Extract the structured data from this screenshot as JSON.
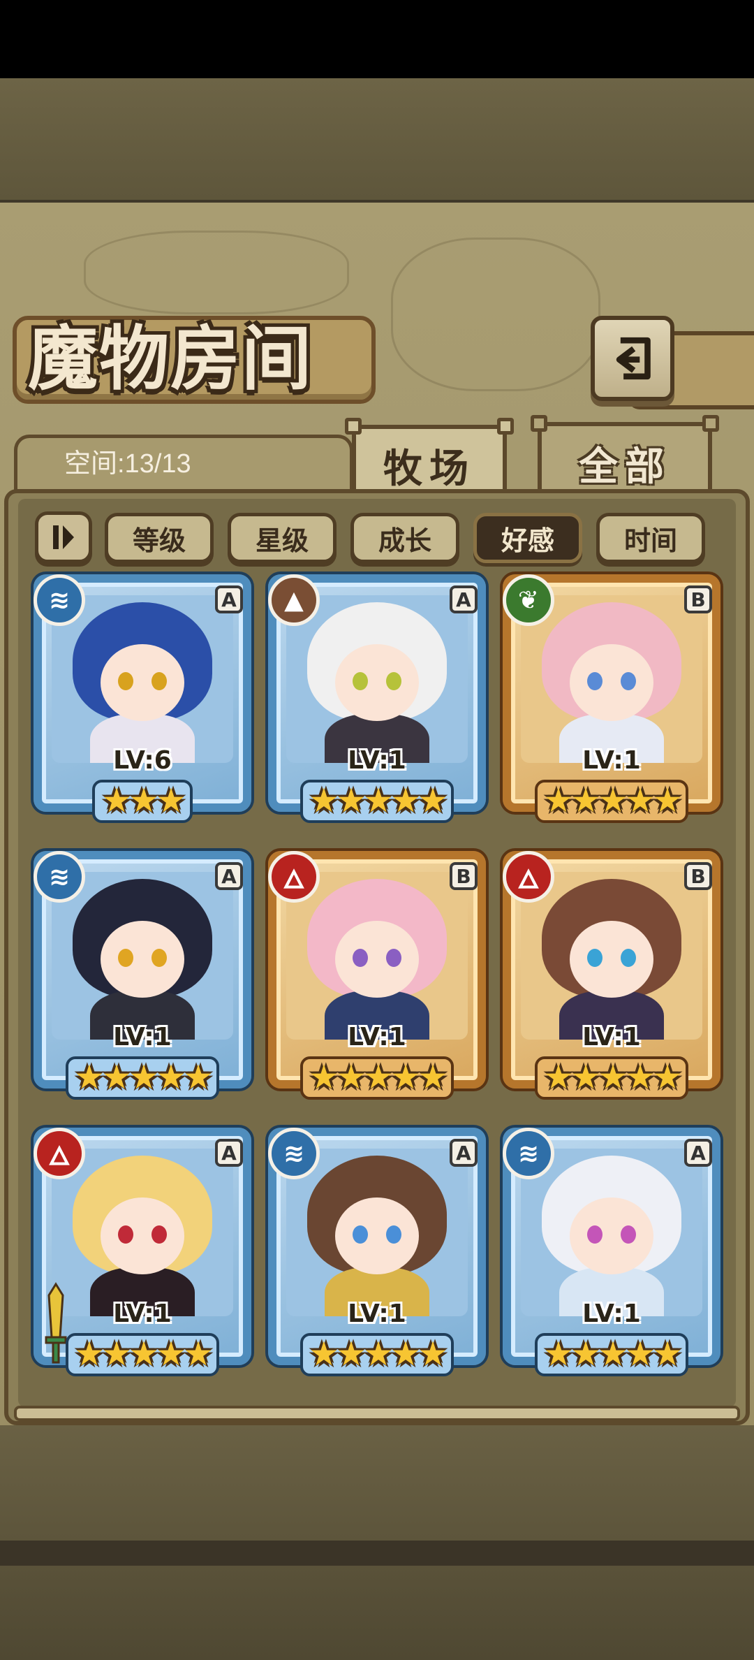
{
  "header": {
    "title": "魔物房间",
    "capacity_text": "空间:13/13"
  },
  "tabs": [
    {
      "label": "牧场",
      "active": true
    },
    {
      "label": "全部",
      "active": false
    }
  ],
  "sort_bar": {
    "buttons": [
      {
        "label": "等级",
        "active": false
      },
      {
        "label": "星级",
        "active": false
      },
      {
        "label": "成长",
        "active": false
      },
      {
        "label": "好感",
        "active": true
      },
      {
        "label": "时间",
        "active": false
      }
    ]
  },
  "monsters": [
    {
      "element": "water",
      "rank": "A",
      "level": "LV:6",
      "stars": 3,
      "frame": "blue",
      "hair": "#2b4fa8",
      "eyes": "#d8a21e",
      "outfit": "#e8e4ef"
    },
    {
      "element": "earth",
      "rank": "A",
      "level": "LV:1",
      "stars": 5,
      "frame": "blue",
      "hair": "#f0f0f0",
      "eyes": "#b6c23a",
      "outfit": "#3b3540"
    },
    {
      "element": "grass",
      "rank": "B",
      "level": "LV:1",
      "stars": 5,
      "frame": "gold",
      "hair": "#f1b9c4",
      "eyes": "#5a8bd6",
      "outfit": "#e6eaf4"
    },
    {
      "element": "water",
      "rank": "A",
      "level": "LV:1",
      "stars": 5,
      "frame": "blue",
      "hair": "#23263a",
      "eyes": "#e0a522",
      "outfit": "#2e2f3a"
    },
    {
      "element": "fire",
      "rank": "B",
      "level": "LV:1",
      "stars": 5,
      "frame": "gold",
      "hair": "#f3b8c8",
      "eyes": "#8a5fc2",
      "outfit": "#2f3f6e"
    },
    {
      "element": "fire",
      "rank": "B",
      "level": "LV:1",
      "stars": 5,
      "frame": "gold",
      "hair": "#7a4a36",
      "eyes": "#3aa3d6",
      "outfit": "#3a3150"
    },
    {
      "element": "fire",
      "rank": "A",
      "level": "LV:1",
      "stars": 5,
      "frame": "blue",
      "hair": "#f2d27a",
      "eyes": "#c02a38",
      "outfit": "#2a1e24"
    },
    {
      "element": "water",
      "rank": "A",
      "level": "LV:1",
      "stars": 5,
      "frame": "blue",
      "hair": "#6a4632",
      "eyes": "#4a8fd8",
      "outfit": "#d9b44a"
    },
    {
      "element": "water",
      "rank": "A",
      "level": "LV:1",
      "stars": 5,
      "frame": "blue",
      "hair": "#eef0f6",
      "eyes": "#c455b8",
      "outfit": "#d8e6f4"
    }
  ],
  "icons": {
    "back": "return-arrow-icon",
    "sort_toggle": "sort-order-icon",
    "water": "water-element-icon",
    "fire": "fire-element-icon",
    "grass": "grass-element-icon",
    "earth": "earth-element-icon"
  }
}
